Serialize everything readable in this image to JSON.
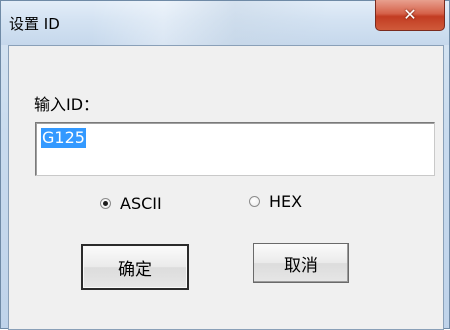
{
  "window": {
    "title": "设置 ID"
  },
  "form": {
    "prompt_label": "输入ID：",
    "id_value": "G125",
    "encoding_options": [
      {
        "label": "ASCII",
        "selected": true
      },
      {
        "label": "HEX",
        "selected": false
      }
    ],
    "ok_label": "确定",
    "cancel_label": "取消"
  },
  "icons": {
    "close": "close-icon"
  },
  "colors": {
    "selection": "#3399ff",
    "close_button": "#c8452b"
  }
}
